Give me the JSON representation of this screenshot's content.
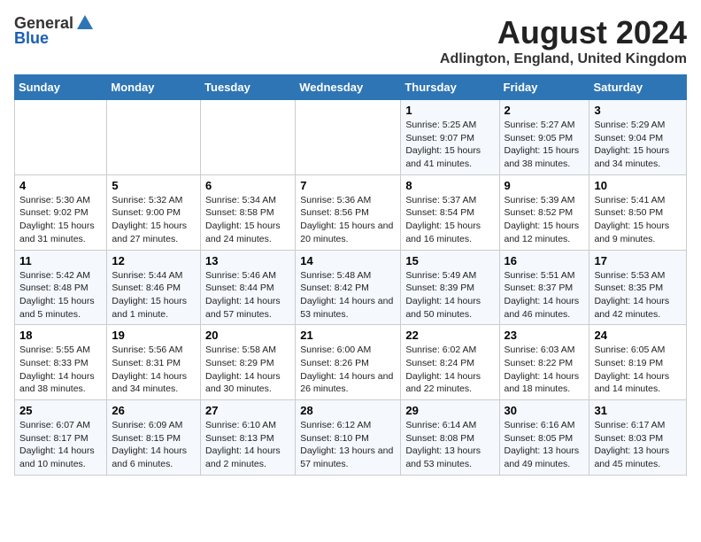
{
  "logo": {
    "general": "General",
    "blue": "Blue"
  },
  "title": "August 2024",
  "subtitle": "Adlington, England, United Kingdom",
  "days_of_week": [
    "Sunday",
    "Monday",
    "Tuesday",
    "Wednesday",
    "Thursday",
    "Friday",
    "Saturday"
  ],
  "weeks": [
    [
      {
        "day": "",
        "info": ""
      },
      {
        "day": "",
        "info": ""
      },
      {
        "day": "",
        "info": ""
      },
      {
        "day": "",
        "info": ""
      },
      {
        "day": "1",
        "info": "Sunrise: 5:25 AM\nSunset: 9:07 PM\nDaylight: 15 hours and 41 minutes."
      },
      {
        "day": "2",
        "info": "Sunrise: 5:27 AM\nSunset: 9:05 PM\nDaylight: 15 hours and 38 minutes."
      },
      {
        "day": "3",
        "info": "Sunrise: 5:29 AM\nSunset: 9:04 PM\nDaylight: 15 hours and 34 minutes."
      }
    ],
    [
      {
        "day": "4",
        "info": "Sunrise: 5:30 AM\nSunset: 9:02 PM\nDaylight: 15 hours and 31 minutes."
      },
      {
        "day": "5",
        "info": "Sunrise: 5:32 AM\nSunset: 9:00 PM\nDaylight: 15 hours and 27 minutes."
      },
      {
        "day": "6",
        "info": "Sunrise: 5:34 AM\nSunset: 8:58 PM\nDaylight: 15 hours and 24 minutes."
      },
      {
        "day": "7",
        "info": "Sunrise: 5:36 AM\nSunset: 8:56 PM\nDaylight: 15 hours and 20 minutes."
      },
      {
        "day": "8",
        "info": "Sunrise: 5:37 AM\nSunset: 8:54 PM\nDaylight: 15 hours and 16 minutes."
      },
      {
        "day": "9",
        "info": "Sunrise: 5:39 AM\nSunset: 8:52 PM\nDaylight: 15 hours and 12 minutes."
      },
      {
        "day": "10",
        "info": "Sunrise: 5:41 AM\nSunset: 8:50 PM\nDaylight: 15 hours and 9 minutes."
      }
    ],
    [
      {
        "day": "11",
        "info": "Sunrise: 5:42 AM\nSunset: 8:48 PM\nDaylight: 15 hours and 5 minutes."
      },
      {
        "day": "12",
        "info": "Sunrise: 5:44 AM\nSunset: 8:46 PM\nDaylight: 15 hours and 1 minute."
      },
      {
        "day": "13",
        "info": "Sunrise: 5:46 AM\nSunset: 8:44 PM\nDaylight: 14 hours and 57 minutes."
      },
      {
        "day": "14",
        "info": "Sunrise: 5:48 AM\nSunset: 8:42 PM\nDaylight: 14 hours and 53 minutes."
      },
      {
        "day": "15",
        "info": "Sunrise: 5:49 AM\nSunset: 8:39 PM\nDaylight: 14 hours and 50 minutes."
      },
      {
        "day": "16",
        "info": "Sunrise: 5:51 AM\nSunset: 8:37 PM\nDaylight: 14 hours and 46 minutes."
      },
      {
        "day": "17",
        "info": "Sunrise: 5:53 AM\nSunset: 8:35 PM\nDaylight: 14 hours and 42 minutes."
      }
    ],
    [
      {
        "day": "18",
        "info": "Sunrise: 5:55 AM\nSunset: 8:33 PM\nDaylight: 14 hours and 38 minutes."
      },
      {
        "day": "19",
        "info": "Sunrise: 5:56 AM\nSunset: 8:31 PM\nDaylight: 14 hours and 34 minutes."
      },
      {
        "day": "20",
        "info": "Sunrise: 5:58 AM\nSunset: 8:29 PM\nDaylight: 14 hours and 30 minutes."
      },
      {
        "day": "21",
        "info": "Sunrise: 6:00 AM\nSunset: 8:26 PM\nDaylight: 14 hours and 26 minutes."
      },
      {
        "day": "22",
        "info": "Sunrise: 6:02 AM\nSunset: 8:24 PM\nDaylight: 14 hours and 22 minutes."
      },
      {
        "day": "23",
        "info": "Sunrise: 6:03 AM\nSunset: 8:22 PM\nDaylight: 14 hours and 18 minutes."
      },
      {
        "day": "24",
        "info": "Sunrise: 6:05 AM\nSunset: 8:19 PM\nDaylight: 14 hours and 14 minutes."
      }
    ],
    [
      {
        "day": "25",
        "info": "Sunrise: 6:07 AM\nSunset: 8:17 PM\nDaylight: 14 hours and 10 minutes."
      },
      {
        "day": "26",
        "info": "Sunrise: 6:09 AM\nSunset: 8:15 PM\nDaylight: 14 hours and 6 minutes."
      },
      {
        "day": "27",
        "info": "Sunrise: 6:10 AM\nSunset: 8:13 PM\nDaylight: 14 hours and 2 minutes."
      },
      {
        "day": "28",
        "info": "Sunrise: 6:12 AM\nSunset: 8:10 PM\nDaylight: 13 hours and 57 minutes."
      },
      {
        "day": "29",
        "info": "Sunrise: 6:14 AM\nSunset: 8:08 PM\nDaylight: 13 hours and 53 minutes."
      },
      {
        "day": "30",
        "info": "Sunrise: 6:16 AM\nSunset: 8:05 PM\nDaylight: 13 hours and 49 minutes."
      },
      {
        "day": "31",
        "info": "Sunrise: 6:17 AM\nSunset: 8:03 PM\nDaylight: 13 hours and 45 minutes."
      }
    ]
  ]
}
